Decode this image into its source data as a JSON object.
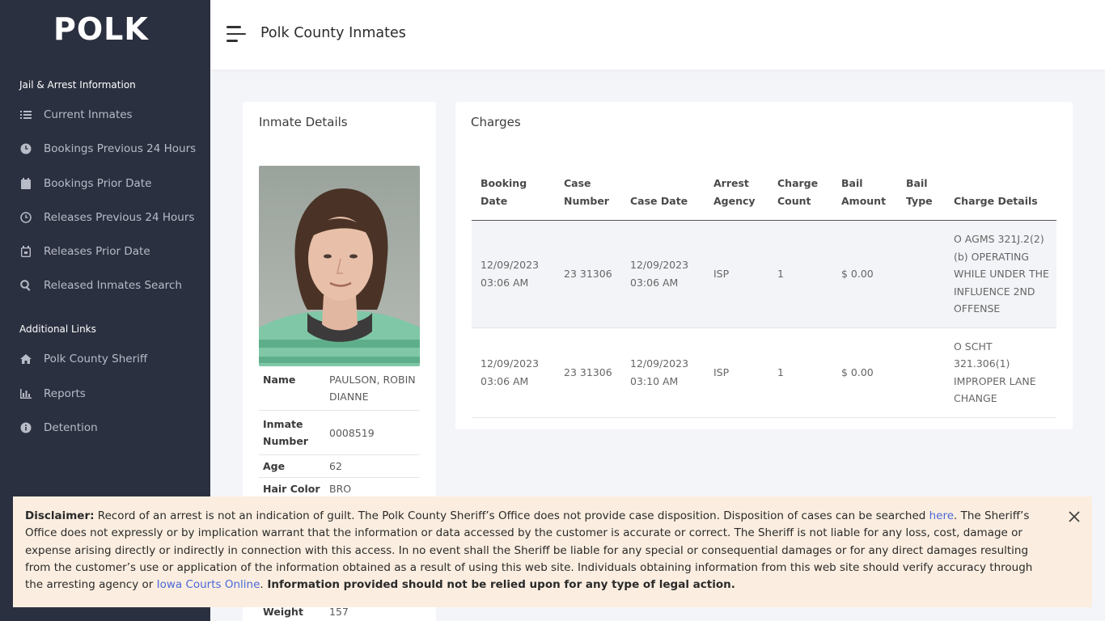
{
  "logo_text": "POLK",
  "sidebar": {
    "section1": "Jail & Arrest Information",
    "items": [
      {
        "label": "Current Inmates",
        "icon": "list-icon"
      },
      {
        "label": "Bookings Previous 24 Hours",
        "icon": "clock-icon"
      },
      {
        "label": "Bookings Prior Date",
        "icon": "calendar-icon"
      },
      {
        "label": "Releases Previous 24 Hours",
        "icon": "clock-outline-icon"
      },
      {
        "label": "Releases Prior Date",
        "icon": "calendar-outline-icon"
      },
      {
        "label": "Released Inmates Search",
        "icon": "search-icon"
      }
    ],
    "section2": "Additional Links",
    "links": [
      {
        "label": "Polk County Sheriff",
        "icon": "home-icon"
      },
      {
        "label": "Reports",
        "icon": "bar-chart-icon"
      },
      {
        "label": "Detention",
        "icon": "info-icon"
      }
    ]
  },
  "header": {
    "title": "Polk County Inmates"
  },
  "inmate": {
    "card_title": "Inmate Details",
    "fields": [
      {
        "label": "Name",
        "value": "PAULSON, ROBIN DIANNE"
      },
      {
        "label": "Inmate Number",
        "value": "0008519"
      },
      {
        "label": "Age",
        "value": "62"
      },
      {
        "label": "Hair Color",
        "value": "BRO"
      },
      {
        "label": "Weight",
        "value": "157"
      }
    ]
  },
  "charges": {
    "card_title": "Charges",
    "columns": [
      "Booking Date",
      "Case Number",
      "Case Date",
      "Arrest Agency",
      "Charge Count",
      "Bail Amount",
      "Bail Type",
      "Charge Details"
    ],
    "rows": [
      [
        "12/09/2023 03:06 AM",
        "23 31306",
        "12/09/2023 03:06 AM",
        "ISP",
        "1",
        "$ 0.00",
        "",
        "O AGMS 321J.2(2)(b) OPERATING WHILE UNDER THE INFLUENCE 2ND OFFENSE"
      ],
      [
        "12/09/2023 03:06 AM",
        "23 31306",
        "12/09/2023 03:10 AM",
        "ISP",
        "1",
        "$ 0.00",
        "",
        "O SCHT 321.306(1) IMPROPER LANE CHANGE"
      ]
    ]
  },
  "disclaimer": {
    "label": "Disclaimer:",
    "text1": " Record of an arrest is not an indication of guilt. The Polk County Sheriff’s Office does not provide case disposition. Disposition of cases can be searched ",
    "link1": "here",
    "text2": ". The Sheriff’s Office does not expressly or by implication warrant that the information or data accessed by the customer is accurate or correct. The Sheriff is not liable for any loss, cost, damage or expense arising directly or indirectly in connection with this access. In no event shall the Sheriff be liable for any special or consequential damages or for any direct damages resulting from the customer’s use or application of the information obtained as a result of using this web site. Individuals obtaining information from this web site should verify accuracy through the arresting agency or ",
    "link2": "Iowa Courts Online",
    "text3": ".",
    "bold_end": " Information provided should not be relied upon for any type of legal action."
  },
  "colors": {
    "sidebar_bg": "#2b3040",
    "link": "#4a68d8",
    "disclaimer_bg": "#fbeee0"
  }
}
